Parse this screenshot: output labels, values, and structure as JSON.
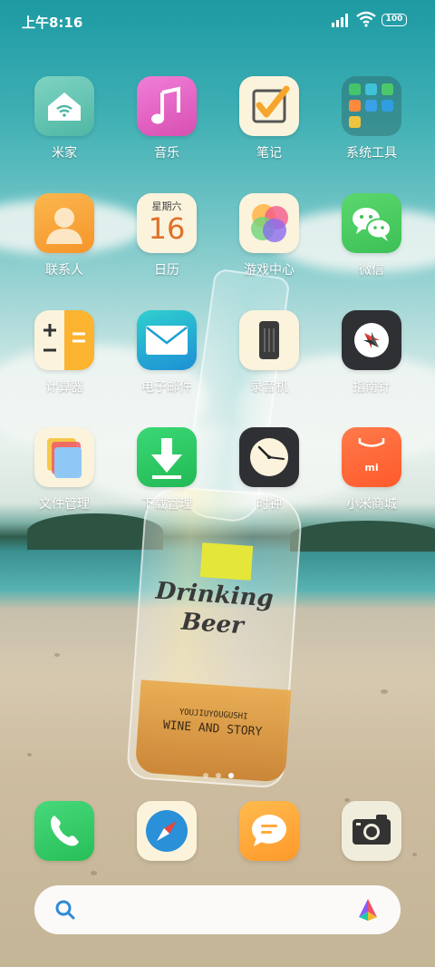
{
  "status_bar": {
    "time": "上午8:16",
    "battery": "100",
    "icons": [
      "signal-icon",
      "wifi-icon",
      "battery-icon"
    ]
  },
  "apps": [
    {
      "name": "mi-home",
      "label": "米家",
      "icon": "mi-home-icon"
    },
    {
      "name": "music",
      "label": "音乐",
      "icon": "music-note-icon"
    },
    {
      "name": "notes",
      "label": "笔记",
      "icon": "notes-check-icon"
    },
    {
      "name": "system-tools",
      "label": "系统工具",
      "icon": "folder-icon"
    },
    {
      "name": "contacts",
      "label": "联系人",
      "icon": "person-icon"
    },
    {
      "name": "calendar",
      "label": "日历",
      "icon": "calendar-icon",
      "weekday": "星期六",
      "day": "16"
    },
    {
      "name": "game-center",
      "label": "游戏中心",
      "icon": "game-center-icon"
    },
    {
      "name": "wechat",
      "label": "微信",
      "icon": "wechat-icon"
    },
    {
      "name": "calculator",
      "label": "计算器",
      "icon": "calculator-icon"
    },
    {
      "name": "email",
      "label": "电子邮件",
      "icon": "envelope-icon"
    },
    {
      "name": "recorder",
      "label": "录音机",
      "icon": "recorder-icon"
    },
    {
      "name": "compass",
      "label": "指南针",
      "icon": "compass-icon"
    },
    {
      "name": "file-manager",
      "label": "文件管理",
      "icon": "file-manager-icon"
    },
    {
      "name": "downloads",
      "label": "下载管理",
      "icon": "download-icon"
    },
    {
      "name": "clock",
      "label": "时钟",
      "icon": "clock-icon"
    },
    {
      "name": "mi-store",
      "label": "小米商城",
      "icon": "mi-store-icon",
      "logo_text": "mi"
    }
  ],
  "dock": [
    {
      "name": "phone",
      "icon": "phone-icon"
    },
    {
      "name": "browser",
      "icon": "browser-compass-icon"
    },
    {
      "name": "messages",
      "icon": "message-icon"
    },
    {
      "name": "camera",
      "icon": "camera-icon"
    }
  ],
  "page_indicator": {
    "pages": 3,
    "current": 3
  },
  "wallpaper": {
    "bottle_label_line1": "Drinking",
    "bottle_label_line2": "Beer",
    "bottle_small_text": "YOUJIUYOUGUSHI",
    "bottle_text": "WINE AND STORY"
  },
  "colors": {
    "mi_home": "#5fc2ae",
    "music": "#e868c7",
    "notes": "#f6a62c",
    "contacts": "#f7a63a",
    "wechat": "#45cc5b",
    "email": "#22a6d8",
    "downloads": "#2dc964",
    "mi_store": "#ff6a3d",
    "phone": "#3fd06e",
    "messages": "#ffa93b"
  }
}
